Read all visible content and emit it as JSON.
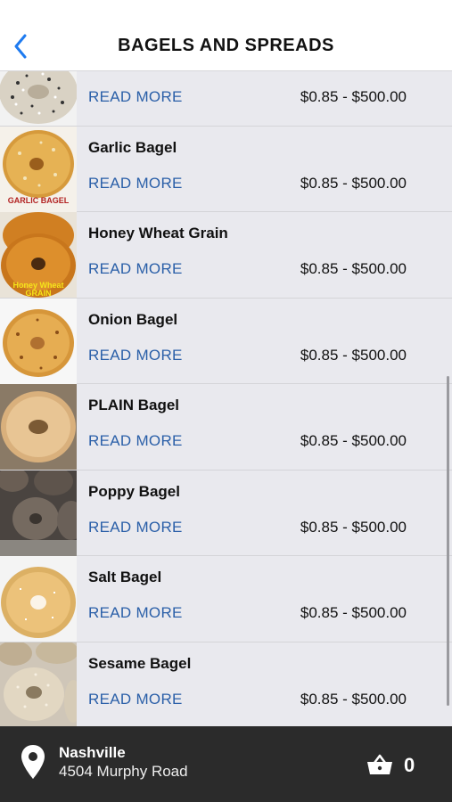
{
  "header": {
    "title": "BAGELS AND SPREADS",
    "back_icon": "chevron-left-icon",
    "accent_color": "#1e7bf0"
  },
  "products": [
    {
      "name": "",
      "link_label": "READ MORE",
      "price": "$0.85 - $500.00",
      "image": "everything-bagel"
    },
    {
      "name": "Garlic Bagel",
      "link_label": "READ MORE",
      "price": "$0.85 - $500.00",
      "image": "garlic-bagel",
      "image_caption": "GARLIC BAGEL"
    },
    {
      "name": "Honey Wheat Grain",
      "link_label": "READ MORE",
      "price": "$0.85 - $500.00",
      "image": "honey-wheat-bagel",
      "image_caption": "Honey Wheat GRAIN"
    },
    {
      "name": "Onion Bagel",
      "link_label": "READ MORE",
      "price": "$0.85 - $500.00",
      "image": "onion-bagel"
    },
    {
      "name": "PLAIN Bagel",
      "link_label": "READ MORE",
      "price": "$0.85 - $500.00",
      "image": "plain-bagel"
    },
    {
      "name": "Poppy Bagel",
      "link_label": "READ MORE",
      "price": "$0.85 - $500.00",
      "image": "poppy-bagel"
    },
    {
      "name": "Salt Bagel",
      "link_label": "READ MORE",
      "price": "$0.85 - $500.00",
      "image": "salt-bagel"
    },
    {
      "name": "Sesame Bagel",
      "link_label": "READ MORE",
      "price": "$0.85 - $500.00",
      "image": "sesame-bagel"
    }
  ],
  "footer": {
    "city": "Nashville",
    "address": "4504 Murphy Road",
    "location_icon": "map-pin-icon",
    "cart_icon": "basket-icon",
    "cart_count": "0",
    "background": "#2b2b2b"
  },
  "colors": {
    "link": "#2a5fa8",
    "row_background": "#e9e9ee"
  }
}
